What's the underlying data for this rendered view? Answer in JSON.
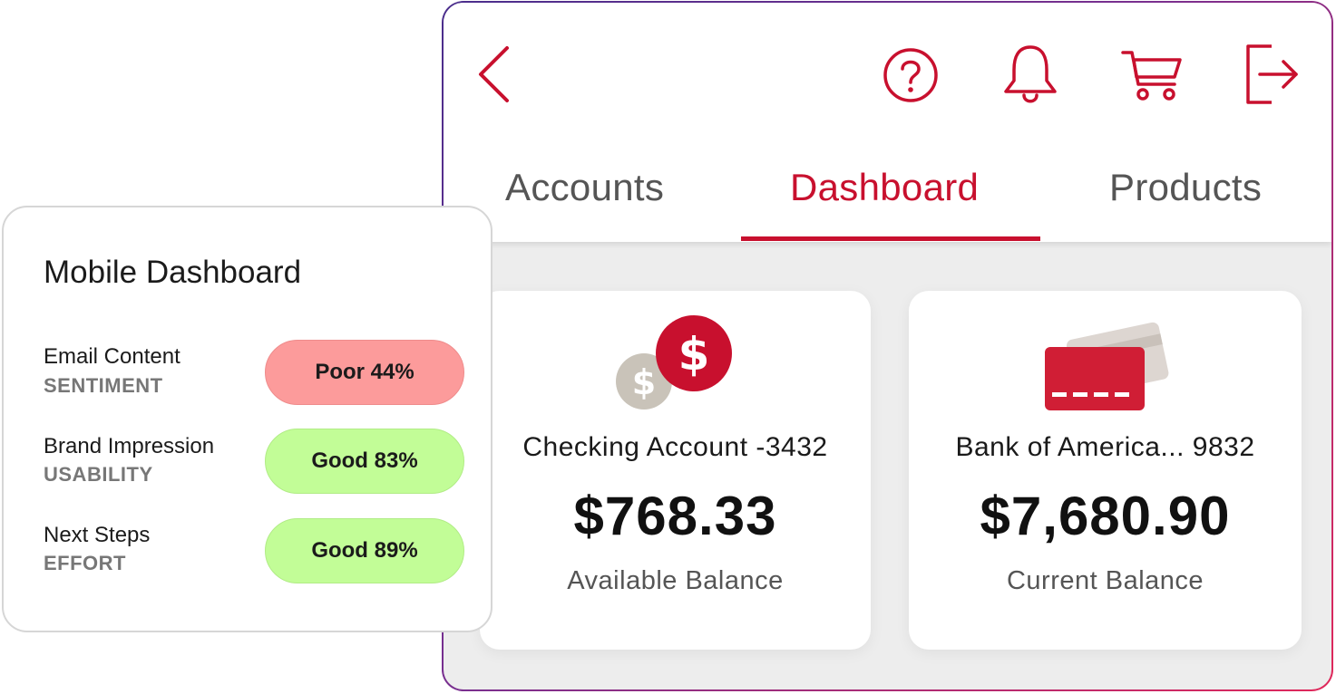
{
  "app": {
    "tabs": [
      {
        "label": "Accounts",
        "active": false
      },
      {
        "label": "Dashboard",
        "active": true
      },
      {
        "label": "Products",
        "active": false
      }
    ],
    "header_icons": [
      "back-chevron-icon",
      "help-icon",
      "bell-icon",
      "cart-icon",
      "logout-icon"
    ],
    "accent_color": "#c8102e",
    "cards": [
      {
        "name": "Checking Account -3432",
        "amount": "$768.33",
        "caption": "Available Balance",
        "icon": "dollar-coins-icon"
      },
      {
        "name": "Bank of America... 9832",
        "amount": "$7,680.90",
        "caption": "Current Balance",
        "icon": "credit-card-icon"
      }
    ]
  },
  "score_panel": {
    "title": "Mobile Dashboard",
    "metrics": [
      {
        "label": "Email Content",
        "sublabel": "SENTIMENT",
        "rating": "Poor 44%",
        "status": "poor",
        "color": "#fc9b9b"
      },
      {
        "label": "Brand Impression",
        "sublabel": "USABILITY",
        "rating": "Good 83%",
        "status": "good",
        "color": "#c2fd97"
      },
      {
        "label": "Next Steps",
        "sublabel": "EFFORT",
        "rating": "Good 89%",
        "status": "good",
        "color": "#c2fd97"
      }
    ]
  }
}
